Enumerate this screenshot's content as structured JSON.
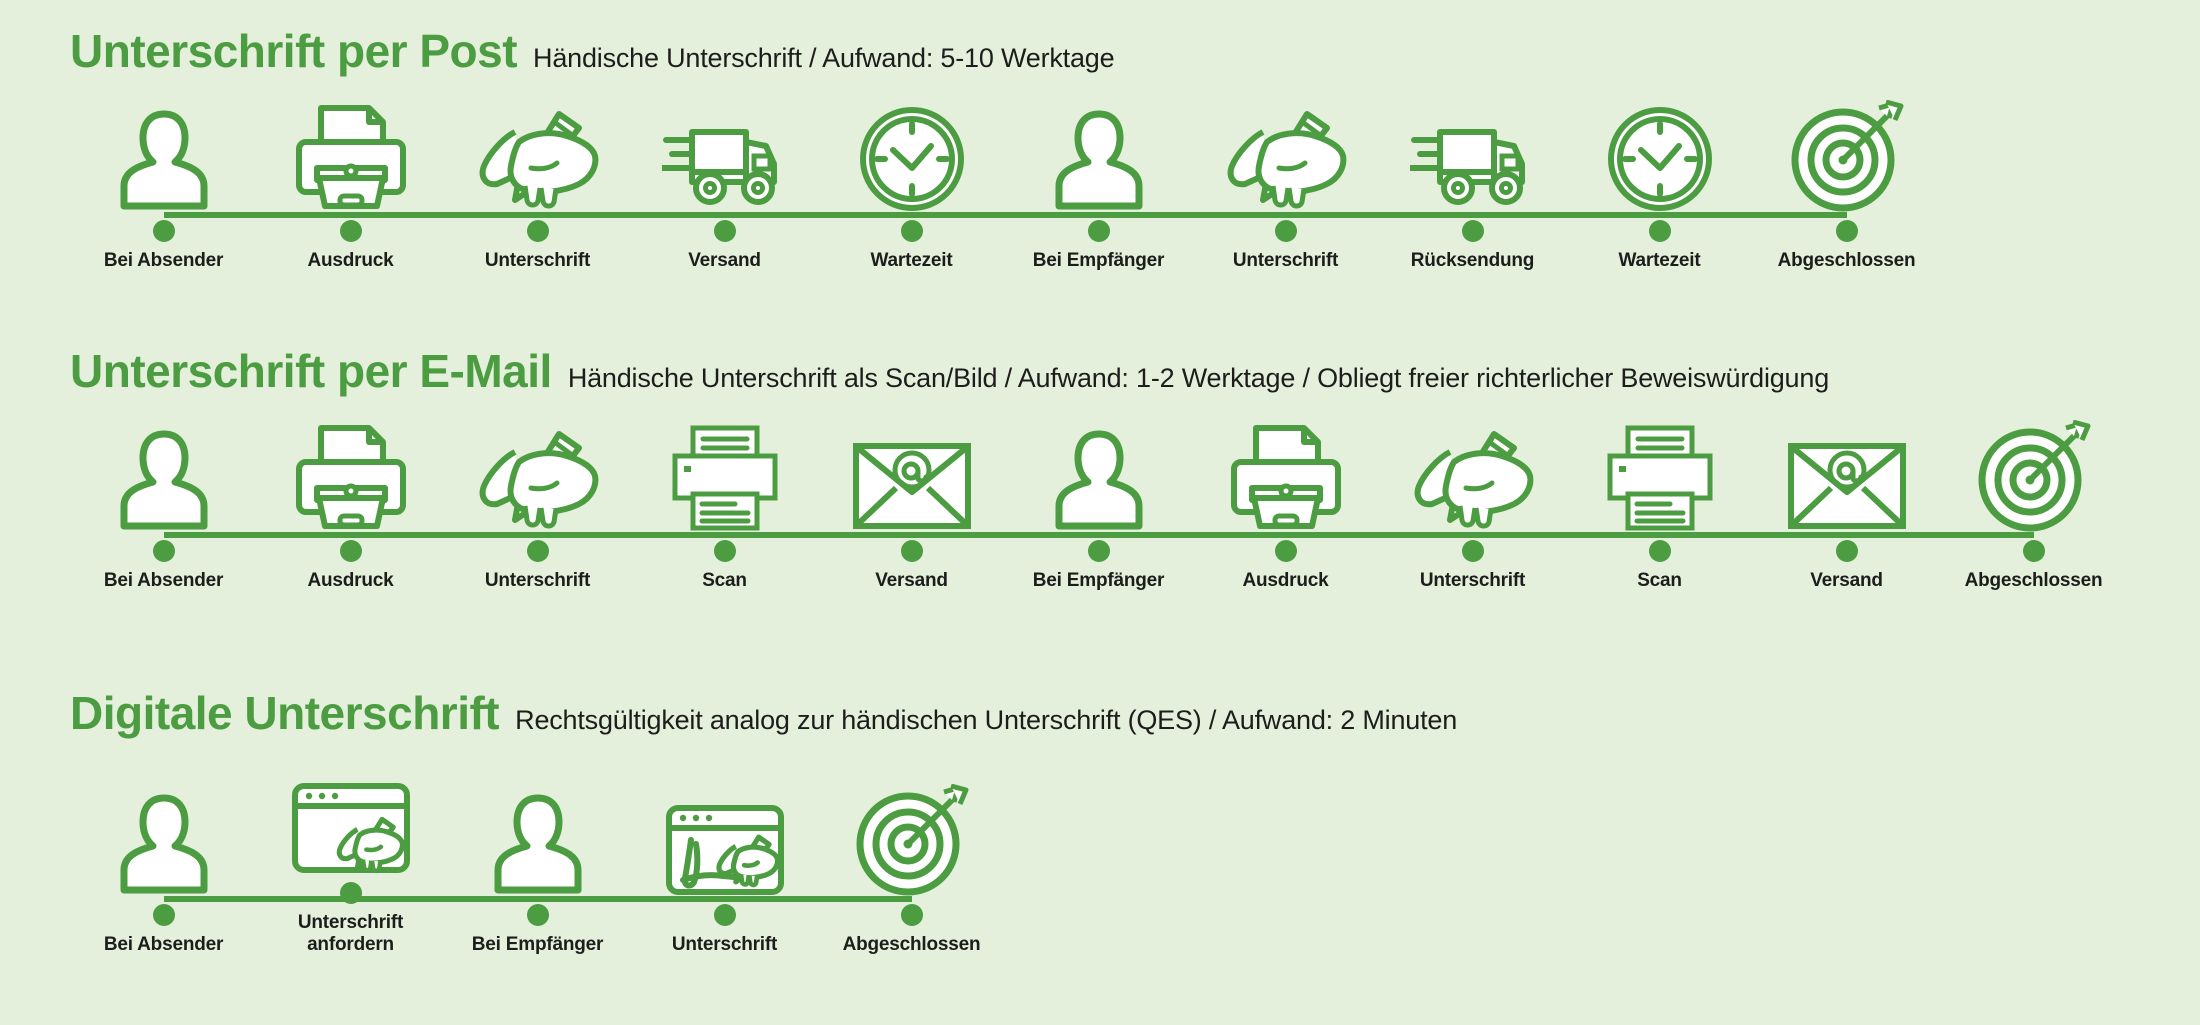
{
  "page": {
    "background_color": "#e4f0dc",
    "accent_color": "#4c9c41",
    "text_color": "#1d1d1b"
  },
  "rows": [
    {
      "title": "Unterschrift per Post",
      "subtitle": "Händische Unterschrift / Aufwand: 5-10 Werktage",
      "steps": [
        {
          "label": "Bei Absender",
          "icon": "person-icon"
        },
        {
          "label": "Ausdruck",
          "icon": "printer-icon"
        },
        {
          "label": "Unterschrift",
          "icon": "hand-signing-icon"
        },
        {
          "label": "Versand",
          "icon": "delivery-truck-icon"
        },
        {
          "label": "Wartezeit",
          "icon": "clock-icon"
        },
        {
          "label": "Bei Empfänger",
          "icon": "person-icon"
        },
        {
          "label": "Unterschrift",
          "icon": "hand-signing-icon"
        },
        {
          "label": "Rücksendung",
          "icon": "delivery-truck-icon"
        },
        {
          "label": "Wartezeit",
          "icon": "clock-icon"
        },
        {
          "label": "Abgeschlossen",
          "icon": "target-arrow-icon"
        }
      ]
    },
    {
      "title": "Unterschrift per E-Mail",
      "subtitle": "Händische Unterschrift als Scan/Bild / Aufwand: 1-2 Werktage / Obliegt freier richterlicher Beweiswürdigung",
      "steps": [
        {
          "label": "Bei Absender",
          "icon": "person-icon"
        },
        {
          "label": "Ausdruck",
          "icon": "printer-icon"
        },
        {
          "label": "Unterschrift",
          "icon": "hand-signing-icon"
        },
        {
          "label": "Scan",
          "icon": "scanner-icon"
        },
        {
          "label": "Versand",
          "icon": "email-envelope-icon"
        },
        {
          "label": "Bei Empfänger",
          "icon": "person-icon"
        },
        {
          "label": "Ausdruck",
          "icon": "printer-icon"
        },
        {
          "label": "Unterschrift",
          "icon": "hand-signing-icon"
        },
        {
          "label": "Scan",
          "icon": "scanner-icon"
        },
        {
          "label": "Versand",
          "icon": "email-envelope-icon"
        },
        {
          "label": "Abgeschlossen",
          "icon": "target-arrow-icon"
        }
      ]
    },
    {
      "title": "Digitale Unterschrift",
      "subtitle": "Rechtsgültigkeit analog zur händischen Unterschrift (QES) / Aufwand: 2 Minuten",
      "steps": [
        {
          "label": "Bei Absender",
          "icon": "person-icon"
        },
        {
          "label": "Unterschrift\nanfordern",
          "icon": "browser-request-signature-icon"
        },
        {
          "label": "Bei Empfänger",
          "icon": "person-icon"
        },
        {
          "label": "Unterschrift",
          "icon": "browser-signature-icon"
        },
        {
          "label": "Abgeschlossen",
          "icon": "target-arrow-icon"
        }
      ]
    }
  ]
}
